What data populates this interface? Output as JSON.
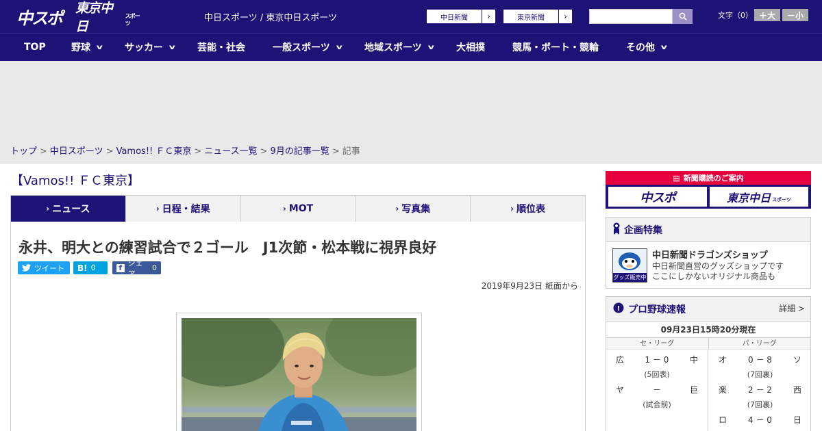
{
  "header": {
    "logo_chuspo": "中スポ",
    "logo_tokyo": "東京中日",
    "logo_tokyo_small": "スポーツ",
    "site_name": "中日スポーツ / 東京中日スポーツ",
    "ext_links": [
      "中日新聞",
      "東京新聞"
    ],
    "search_placeholder": "",
    "font_size_label": "文字（0）",
    "font_large": "＋大",
    "font_small": "－小"
  },
  "nav": [
    {
      "label": "TOP",
      "has_dropdown": false
    },
    {
      "label": "野球",
      "has_dropdown": true
    },
    {
      "label": "サッカー",
      "has_dropdown": true
    },
    {
      "label": "芸能・社会",
      "has_dropdown": false
    },
    {
      "label": "一般スポーツ",
      "has_dropdown": true
    },
    {
      "label": "地域スポーツ",
      "has_dropdown": true
    },
    {
      "label": "大相撲",
      "has_dropdown": false
    },
    {
      "label": "競馬・ボート・競輪",
      "has_dropdown": false
    },
    {
      "label": "その他",
      "has_dropdown": true
    }
  ],
  "breadcrumb": [
    "トップ",
    "中日スポーツ",
    "Vamos!! ＦＣ東京",
    "ニュース一覧",
    "9月の記事一覧",
    "記事"
  ],
  "section_title": "【Vamos!! ＦＣ東京】",
  "tabs": [
    {
      "label": "ニュース",
      "active": true
    },
    {
      "label": "日程・結果",
      "active": false
    },
    {
      "label": "MOT",
      "active": false
    },
    {
      "label": "写真集",
      "active": false
    },
    {
      "label": "順位表",
      "active": false
    }
  ],
  "article": {
    "headline": "永井、明大との練習試合で２ゴール　J1次節・松本戦に視界良好",
    "tweet_label": "ツイート",
    "hatena_icon": "B!",
    "hatena_count": "0",
    "fb_label": "シェア",
    "fb_count": "0",
    "date": "2019年9月23日 紙面から"
  },
  "sidebar": {
    "subscribe_head": "新聞購読のご案内",
    "subscribe_logo_1": "中スポ",
    "subscribe_logo_2": "東京中日",
    "subscribe_logo_2_small": "スポーツ",
    "feature_head": "企画特集",
    "feature_title": "中日新聞ドラゴンズショップ",
    "feature_desc_1": "中日新聞直営のグッズショップです",
    "feature_desc_2": "ここにしかないオリジナル商品も",
    "feature_thumb_text": "グッズ販売中",
    "score_head": "プロ野球速報",
    "score_more": "詳細 >",
    "score_time": "09月23日15時20分現在",
    "leagues": [
      "セ・リーグ",
      "パ・リーグ"
    ],
    "central_games": [
      {
        "home": "広",
        "score": "1 － 0",
        "away": "中",
        "status": "(5回表)"
      },
      {
        "home": "ヤ",
        "score": "－",
        "away": "巨",
        "status": "(試合前)"
      }
    ],
    "pacific_games": [
      {
        "home": "オ",
        "score": "0 － 8",
        "away": "ソ",
        "status": "(7回裏)"
      },
      {
        "home": "楽",
        "score": "2 － 2",
        "away": "西",
        "status": "(7回裏)"
      },
      {
        "home": "ロ",
        "score": "4 － 0",
        "away": "日",
        "status": ""
      }
    ]
  },
  "colors": {
    "brand": "#1d1276",
    "accent_red": "#e6003e",
    "twitter": "#1da1f2",
    "hatena": "#00a4de",
    "facebook": "#3b5998"
  }
}
